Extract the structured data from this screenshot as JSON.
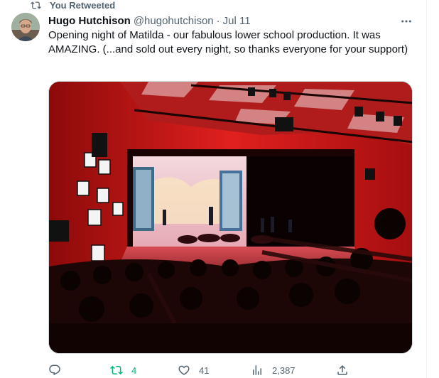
{
  "social_context": {
    "label": "You Retweeted",
    "icon": "retweet-icon"
  },
  "author": {
    "name": "Hugo Hutchison",
    "handle": "@hugohutchison",
    "separator": "·",
    "date": "Jul 11"
  },
  "tweet": {
    "text": "Opening night of Matilda - our fabulous lower school production. It was AMAZING. (...and sold out every night, so thanks everyone for your support)"
  },
  "actions": {
    "reply": {
      "icon": "reply-icon",
      "count": ""
    },
    "retweet": {
      "icon": "retweet-icon",
      "count": "4",
      "color": "#00ba7c"
    },
    "like": {
      "icon": "heart-icon",
      "count": "41"
    },
    "views": {
      "icon": "views-chart-icon",
      "count": "2,387"
    },
    "share": {
      "icon": "share-icon"
    }
  },
  "colors": {
    "text_primary": "#0f1419",
    "text_secondary": "#536471",
    "retweeted_green": "#00ba7c",
    "border": "#cfd9de"
  }
}
